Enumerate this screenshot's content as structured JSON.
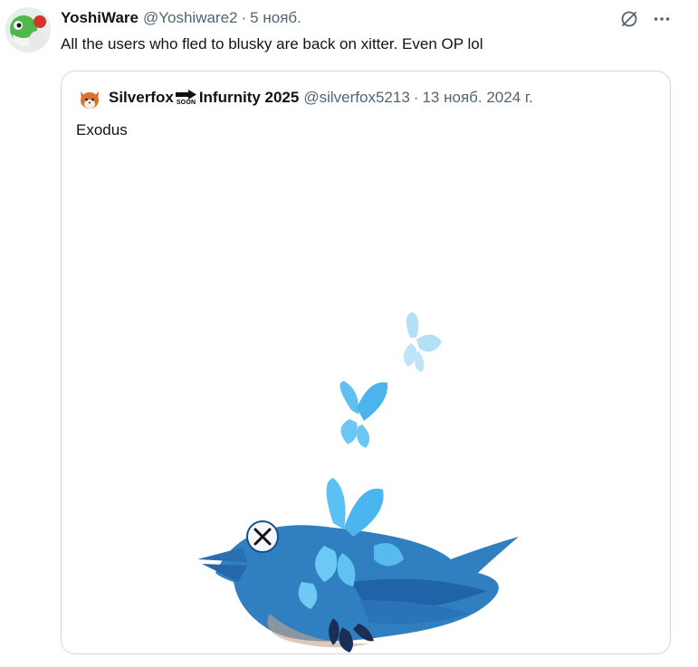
{
  "post": {
    "author_name": "YoshiWare",
    "author_handle": "@Yoshiware2",
    "separator": "·",
    "timestamp": "5 нояб.",
    "text": "All the users who fled to blusky are back on xitter. Even OP lol",
    "actions": {
      "grok_icon": "grok-icon",
      "more_icon": "more-icon"
    }
  },
  "quote": {
    "author_name_part1": "Silverfox",
    "badge_text": "SOON",
    "author_name_part2": "Infurnity 2025",
    "author_handle": "@silverfox5213",
    "separator": "·",
    "timestamp": "13 нояб. 2024 г.",
    "text": "Exodus",
    "media_icon": "bird-butterflies-illustration"
  },
  "colors": {
    "text_primary": "#0f1419",
    "text_secondary": "#536471",
    "border": "#cfd9de",
    "bird_blue": "#2f7fc1",
    "butterfly_blue": "#6fc4f0"
  }
}
